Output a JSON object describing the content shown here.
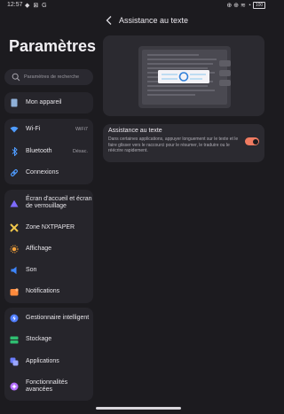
{
  "status": {
    "time": "12:57",
    "left_icons": "◆ ⊠ G",
    "right_icons": "⊕ ⊕ ≋ ◔",
    "battery": "100"
  },
  "sidebar": {
    "title": "Paramètres",
    "search_placeholder": "Paramètres de recherche",
    "items": [
      {
        "label": "Mon appareil",
        "icon": "device-icon",
        "color": "#8fb0d8"
      },
      {
        "label": "Wi-Fi",
        "value": "WiFi7",
        "icon": "wifi-icon",
        "color": "#4f9cff"
      },
      {
        "label": "Bluetooth",
        "value": "Désac.",
        "icon": "bluetooth-icon",
        "color": "#4f9cff"
      },
      {
        "label": "Connexions",
        "icon": "link-icon",
        "color": "#4f9cff"
      },
      {
        "label": "Écran d'accueil et écran de verrouillage",
        "icon": "home-screen-icon",
        "color": "#7e6bff"
      },
      {
        "label": "Zone NXTPAPER",
        "icon": "nxtpaper-icon",
        "color": "#f2c84b"
      },
      {
        "label": "Affichage",
        "icon": "display-icon",
        "color": "#f3a13a"
      },
      {
        "label": "Son",
        "icon": "sound-icon",
        "color": "#3d86ff"
      },
      {
        "label": "Notifications",
        "icon": "notifications-icon",
        "color": "#ff8a3c"
      },
      {
        "label": "Gestionnaire intelligent",
        "icon": "smart-manager-icon",
        "color": "#4f7dff"
      },
      {
        "label": "Stockage",
        "icon": "storage-icon",
        "color": "#2fbf71"
      },
      {
        "label": "Applications",
        "icon": "apps-icon",
        "color": "#6b7dff"
      },
      {
        "label": "Fonctionnalités avancées",
        "icon": "advanced-features-icon",
        "color": "#b26bff"
      }
    ]
  },
  "detail": {
    "title": "Assistance au texte",
    "setting_title": "Assistance au texte",
    "setting_desc": "Dans certaines applications, appuyer longuement sur le texte et le faire glisser vers le raccourci pour le résumer, le traduire ou le réécrire rapidement.",
    "toggle_on": true,
    "accent": "#f07b61"
  }
}
